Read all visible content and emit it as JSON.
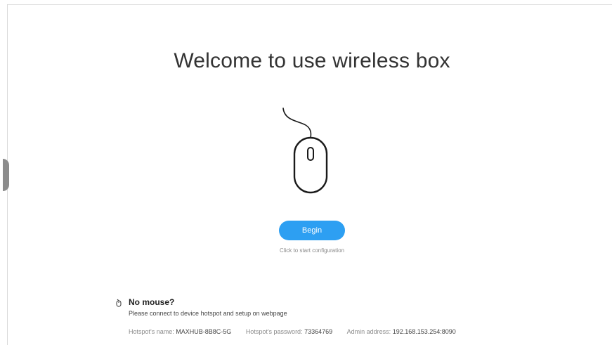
{
  "title": "Welcome to use wireless box",
  "begin": {
    "label": "Begin",
    "hint": "Click to start configuration"
  },
  "no_mouse": {
    "heading": "No mouse?",
    "description": "Please connect to device hotspot and setup on webpage",
    "info": {
      "hotspot_name_label": "Hotspot's name:",
      "hotspot_name_value": "MAXHUB-8B8C-5G",
      "hotspot_password_label": "Hotspot's password:",
      "hotspot_password_value": "73364769",
      "admin_address_label": "Admin address:",
      "admin_address_value": "192.168.153.254:8090"
    }
  },
  "colors": {
    "accent": "#2d9ff2",
    "text_primary": "#333333",
    "text_secondary": "#8a8a8a"
  },
  "icons": {
    "illustration": "mouse-illustration",
    "no_mouse": "mouse-icon"
  }
}
